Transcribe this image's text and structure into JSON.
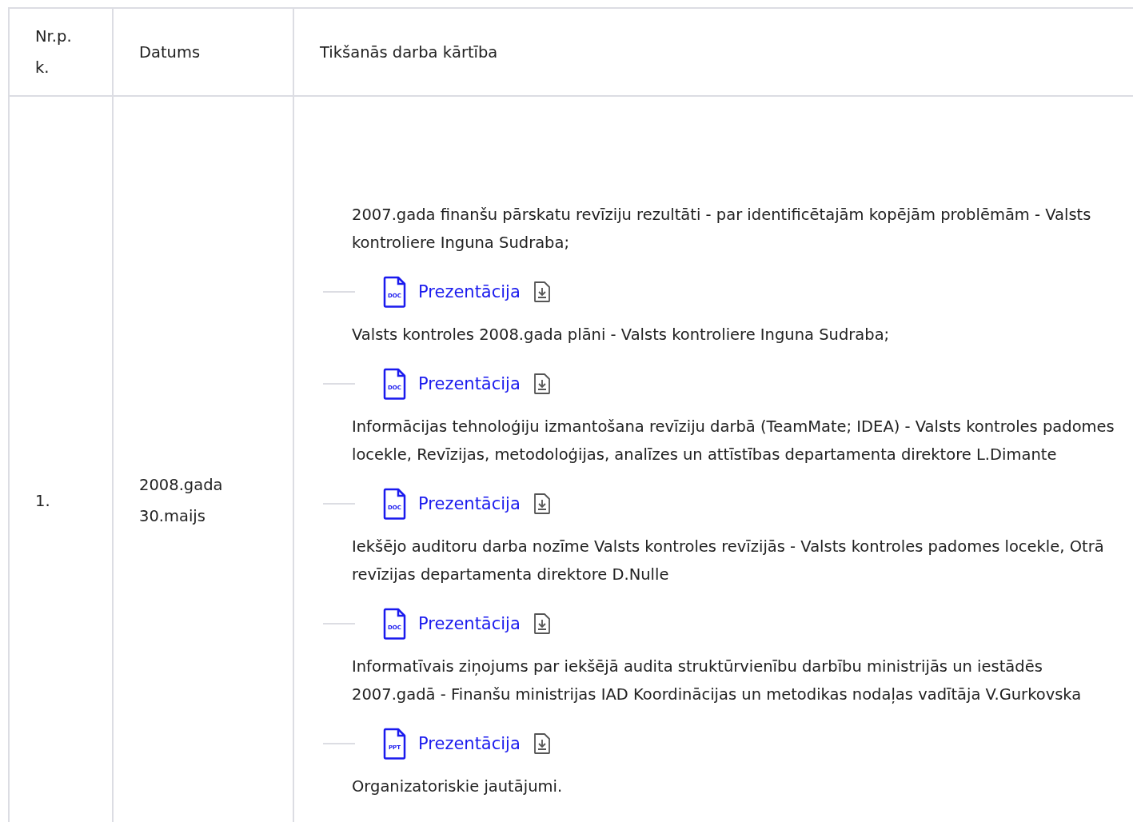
{
  "table": {
    "columns": [
      "Nr.p. k.",
      "Datums",
      "Tikšanās darba kārtība"
    ],
    "rows": [
      {
        "number": "1.",
        "date": "2008.gada 30.maijs",
        "agenda": [
          {
            "text": "2007.gada finanšu pārskatu revīziju rezultāti - par identificētajām kopējām problēmām - Valsts kontroliere  Inguna Sudraba;",
            "attachment": {
              "file_type": "DOC",
              "link": "Prezentācija"
            }
          },
          {
            "text": "Valsts kontroles 2008.gada plāni -  Valsts kontroliere Inguna Sudraba;",
            "attachment": {
              "file_type": "DOC",
              "link": "Prezentācija"
            }
          },
          {
            "text": "Informācijas tehnoloģiju izmantošana revīziju darbā (TeamMate; IDEA)   - Valsts kontroles padomes locekle, Revīzijas, metodoloģijas, analīzes un attīstības departamenta direktore L.Dimante",
            "attachment": {
              "file_type": "DOC",
              "link": "Prezentācija"
            }
          },
          {
            "text": "Iekšējo auditoru darba nozīme Valsts kontroles revīzijās - Valsts kontroles padomes locekle, Otrā revīzijas departamenta direktore D.Nulle",
            "attachment": {
              "file_type": "DOC",
              "link": "Prezentācija"
            }
          },
          {
            "text": "Informatīvais ziņojums par iekšējā audita struktūrvienību darbību ministrijās un iestādēs 2007.gadā - Finanšu ministrijas IAD Koordinācijas un metodikas nodaļas vadītāja V.Gurkovska",
            "attachment": {
              "file_type": "PPT",
              "link": "Prezentācija"
            }
          },
          {
            "text": "Organizatoriskie jautājumi."
          }
        ]
      }
    ]
  }
}
